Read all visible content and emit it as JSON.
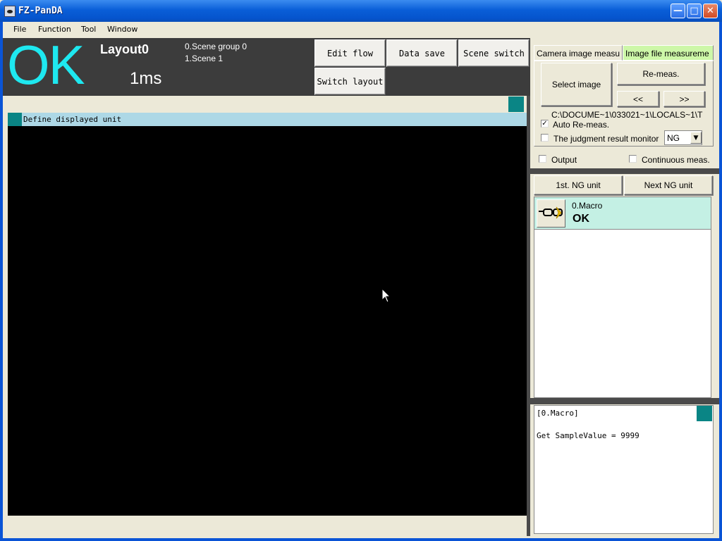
{
  "window": {
    "title": "FZ-PanDA",
    "controls": [
      "minimize",
      "maximize",
      "close"
    ]
  },
  "menu": {
    "items": [
      "File",
      "Function",
      "Tool",
      "Window"
    ]
  },
  "status": {
    "judgement": "OK",
    "layout": "Layout0",
    "time": "1ms",
    "scene_group": "0.Scene group 0",
    "scene": "1.Scene 1"
  },
  "toolbar": {
    "edit_flow": "Edit flow",
    "data_save": "Data save",
    "scene_switch": "Scene switch",
    "switch_layout": "Switch layout"
  },
  "image_panel": {
    "unit_label": "Define displayed unit"
  },
  "tabs": {
    "camera": "Camera image measu",
    "file": "Image file measureme",
    "active": "file"
  },
  "file_panel": {
    "select_image": "Select image",
    "remeas": "Re-meas.",
    "prev": "<<",
    "next": ">>",
    "path": "C:\\DOCUME~1\\033021~1\\LOCALS~1\\T",
    "auto_remeas": {
      "label": "Auto Re-meas.",
      "checked": true
    },
    "judgment_monitor": {
      "label": "The judgment result monitor",
      "checked": false
    },
    "judgment_value": "NG"
  },
  "options": {
    "output": {
      "label": "Output",
      "checked": false
    },
    "continuous": {
      "label": "Continuous meas.",
      "checked": false
    }
  },
  "ng_nav": {
    "first": "1st. NG unit",
    "next": "Next NG unit"
  },
  "units": [
    {
      "name": "0.Macro",
      "result": "OK",
      "icon": "glasses-icon"
    }
  ],
  "output_text": {
    "header": "[0.Macro]",
    "line": "Get SampleValue = 9999"
  },
  "colors": {
    "judgement_ok": "#1ee8f0",
    "active_tab": "#cdf7a8",
    "unit_row": "#c4f0e4",
    "unit_bar": "#add8e6",
    "accent_teal": "#0a8585"
  }
}
